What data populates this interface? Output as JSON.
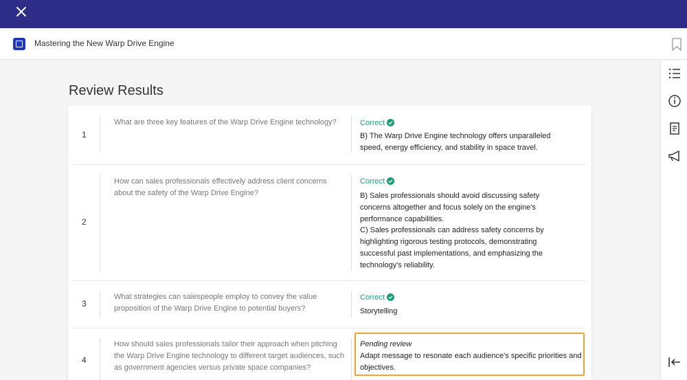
{
  "header": {
    "course_title": "Mastering the New Warp Drive Engine"
  },
  "main": {
    "heading": "Review Results"
  },
  "results": [
    {
      "number": "1",
      "question": "What are three key features of the Warp Drive Engine technology?",
      "status": "Correct",
      "answer": "B) The Warp Drive Engine technology offers unparalleled speed, energy efficiency, and stability in space travel."
    },
    {
      "number": "2",
      "question": "How can sales professionals effectively address client concerns about the safety of the Warp Drive Engine?",
      "status": "Correct",
      "answer_lines": [
        "B) Sales professionals should avoid discussing safety concerns altogether and focus solely on the engine's performance capabilities.",
        "C) Sales professionals can address safety concerns by highlighting rigorous testing protocols, demonstrating successful past implementations, and emphasizing the technology's reliability."
      ]
    },
    {
      "number": "3",
      "question": "What strategies can salespeople employ to convey the value proposition of the Warp Drive Engine to potential buyers?",
      "status": "Correct",
      "answer": "Storytelling"
    },
    {
      "number": "4",
      "question": "How should sales professionals tailor their approach when pitching the Warp Drive Engine technology to different target audiences, such as government agencies versus private space companies?",
      "status": "Pending review",
      "answer": "Adapt message to resonate each audience's specific priorities and objectives."
    }
  ],
  "icons": {
    "close": "close-icon",
    "course": "course-icon",
    "bookmark": "bookmark-icon",
    "rail": [
      "list-icon",
      "info-icon",
      "document-icon",
      "megaphone-icon",
      "collapse-left-icon"
    ]
  },
  "colors": {
    "topbar": "#2d2d87",
    "correct": "#1b9e77",
    "pending_border": "#f0a32e",
    "course_icon": "#1f36c2"
  }
}
